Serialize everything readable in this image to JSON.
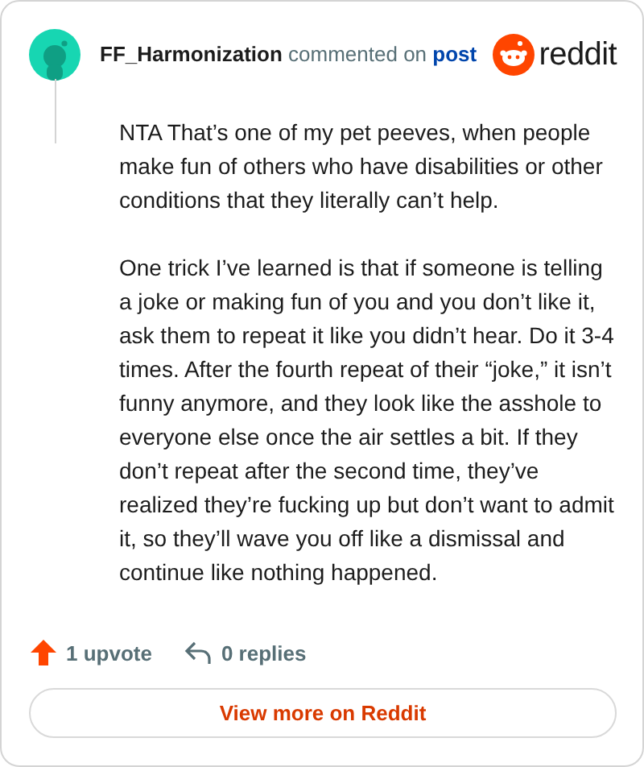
{
  "comment": {
    "author": "FF_Harmonization",
    "action": "commented on",
    "link": "post",
    "brand": "reddit",
    "paragraphs": [
      "NTA That’s one of my pet peeves, when people make fun of others who have disabilities or other conditions that they literally can’t help.",
      "One trick I’ve learned is that if someone is telling a joke or making fun of you and you don’t like it, ask them to repeat it like you didn’t hear. Do it 3-4 times. After the fourth repeat of their “joke,” it isn’t funny anymore, and they look like the asshole to everyone else once the air settles a bit. If they don’t repeat after the second time, they’ve realized they’re fucking up but don’t want to admit it, so they’ll wave you off like a dismissal and continue like nothing happened."
    ]
  },
  "footer": {
    "upvotes": "1 upvote",
    "replies": "0 replies",
    "button": "View more on Reddit"
  }
}
